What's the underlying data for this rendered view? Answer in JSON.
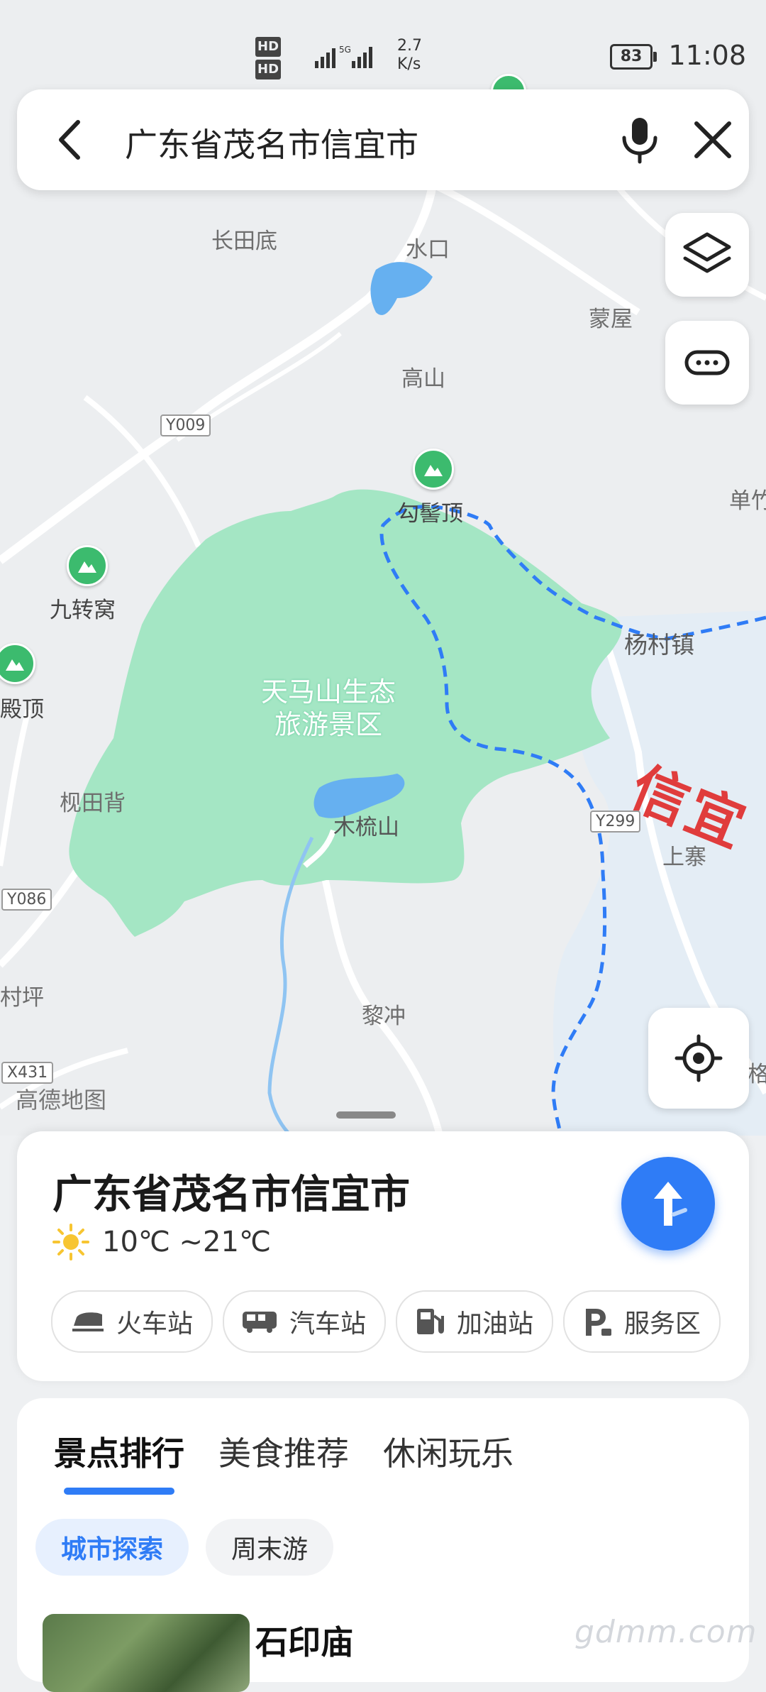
{
  "status_bar": {
    "hd_1": "HD",
    "hd_2": "HD",
    "speed_value": "2.7",
    "speed_unit": "K/s",
    "battery": "83",
    "time": "11:08",
    "network": "5G"
  },
  "search": {
    "query": "广东省茂名市信宜市"
  },
  "map": {
    "labels": {
      "changtiandi": "长田底",
      "shuikou": "水口",
      "mengwu": "蒙屋",
      "gaoshan": "高山",
      "goujiding": "勾髻顶",
      "danzhu": "单竹",
      "jiuzhuanwo": "九转窝",
      "dianding": "殿顶",
      "yangcun": "杨村镇",
      "xiantianbei": "枧田背",
      "mushushan": "木梳山",
      "shangzhai": "上寨",
      "lichong": "黎冲",
      "cunping": "村坪",
      "ge": "格"
    },
    "park_name_line1": "天马山生态",
    "park_name_line2": "旅游景区",
    "city_overlay": "信宜",
    "roads": {
      "y009": "Y009",
      "y299": "Y299",
      "y086": "Y086",
      "x431": "X431"
    },
    "provider": "高德地图",
    "colors": {
      "park": "#a4e6c4",
      "boundary": "#2f7cf6",
      "city_area": "#e4edf5",
      "water": "#66b0f0"
    }
  },
  "place_card": {
    "title": "广东省茂名市信宜市",
    "weather_icon": "sun-icon",
    "temperature": "10℃ ~21℃",
    "quick_links": [
      {
        "label": "火车站",
        "icon": "train-icon"
      },
      {
        "label": "汽车站",
        "icon": "bus-icon"
      },
      {
        "label": "加油站",
        "icon": "gas-station-icon"
      },
      {
        "label": "服务区",
        "icon": "service-area-icon"
      }
    ]
  },
  "recommendations": {
    "tabs": [
      "景点排行",
      "美食推荐",
      "休闲玩乐"
    ],
    "active_tab": "景点排行",
    "pills": [
      "城市探索",
      "周末游"
    ],
    "first_item": "石印庙"
  },
  "watermark": "gdmm.com"
}
